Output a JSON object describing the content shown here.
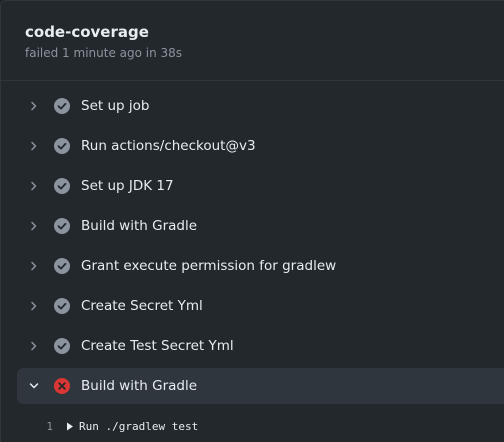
{
  "job": {
    "title": "code-coverage",
    "status_text": "failed 1 minute ago in 38s"
  },
  "steps": [
    {
      "label": "Set up job",
      "status": "success",
      "expanded": false
    },
    {
      "label": "Run actions/checkout@v3",
      "status": "success",
      "expanded": false
    },
    {
      "label": "Set up JDK 17",
      "status": "success",
      "expanded": false
    },
    {
      "label": "Build with Gradle",
      "status": "success",
      "expanded": false
    },
    {
      "label": "Grant execute permission for gradlew",
      "status": "success",
      "expanded": false
    },
    {
      "label": "Create Secret Yml",
      "status": "success",
      "expanded": false
    },
    {
      "label": "Create Test Secret Yml",
      "status": "success",
      "expanded": false
    },
    {
      "label": "Build with Gradle",
      "status": "failure",
      "expanded": true
    }
  ],
  "log": {
    "line_number": "1",
    "text": "Run ./gradlew test"
  },
  "colors": {
    "background": "#23282d",
    "success_icon": "#8b949e",
    "failure_icon": "#da3633",
    "text": "#e6edf3",
    "muted": "#8b949e"
  }
}
